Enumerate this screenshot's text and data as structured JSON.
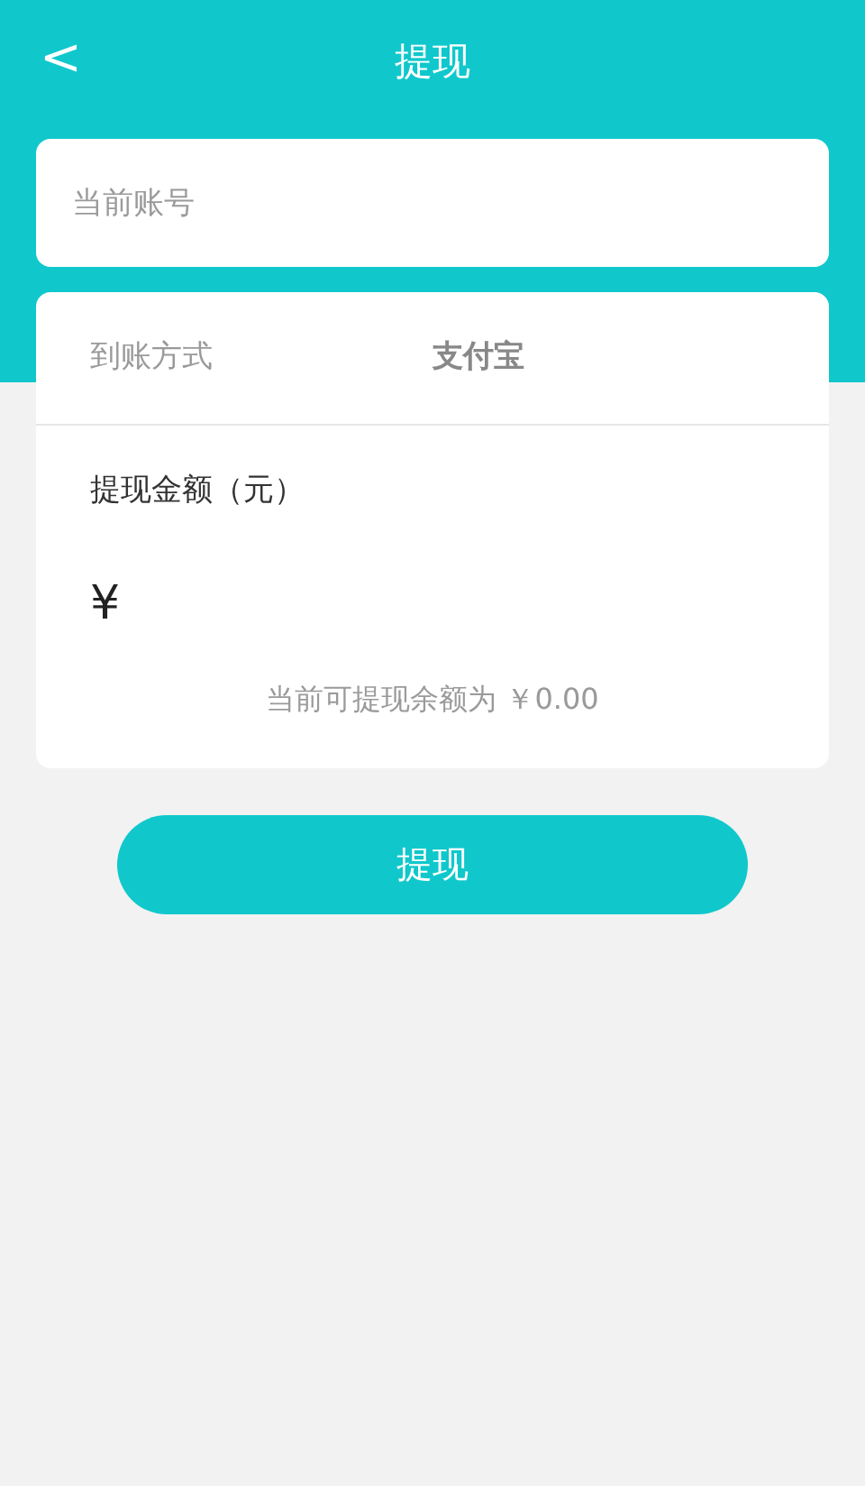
{
  "header": {
    "back": "<",
    "title": "提现"
  },
  "account_field": {
    "placeholder": "当前账号"
  },
  "method": {
    "label": "到账方式",
    "value": "支付宝"
  },
  "amount": {
    "label": "提现金额（元）",
    "currency": "¥",
    "available": "当前可提现余额为 ￥0.00"
  },
  "submit_button": "提现"
}
